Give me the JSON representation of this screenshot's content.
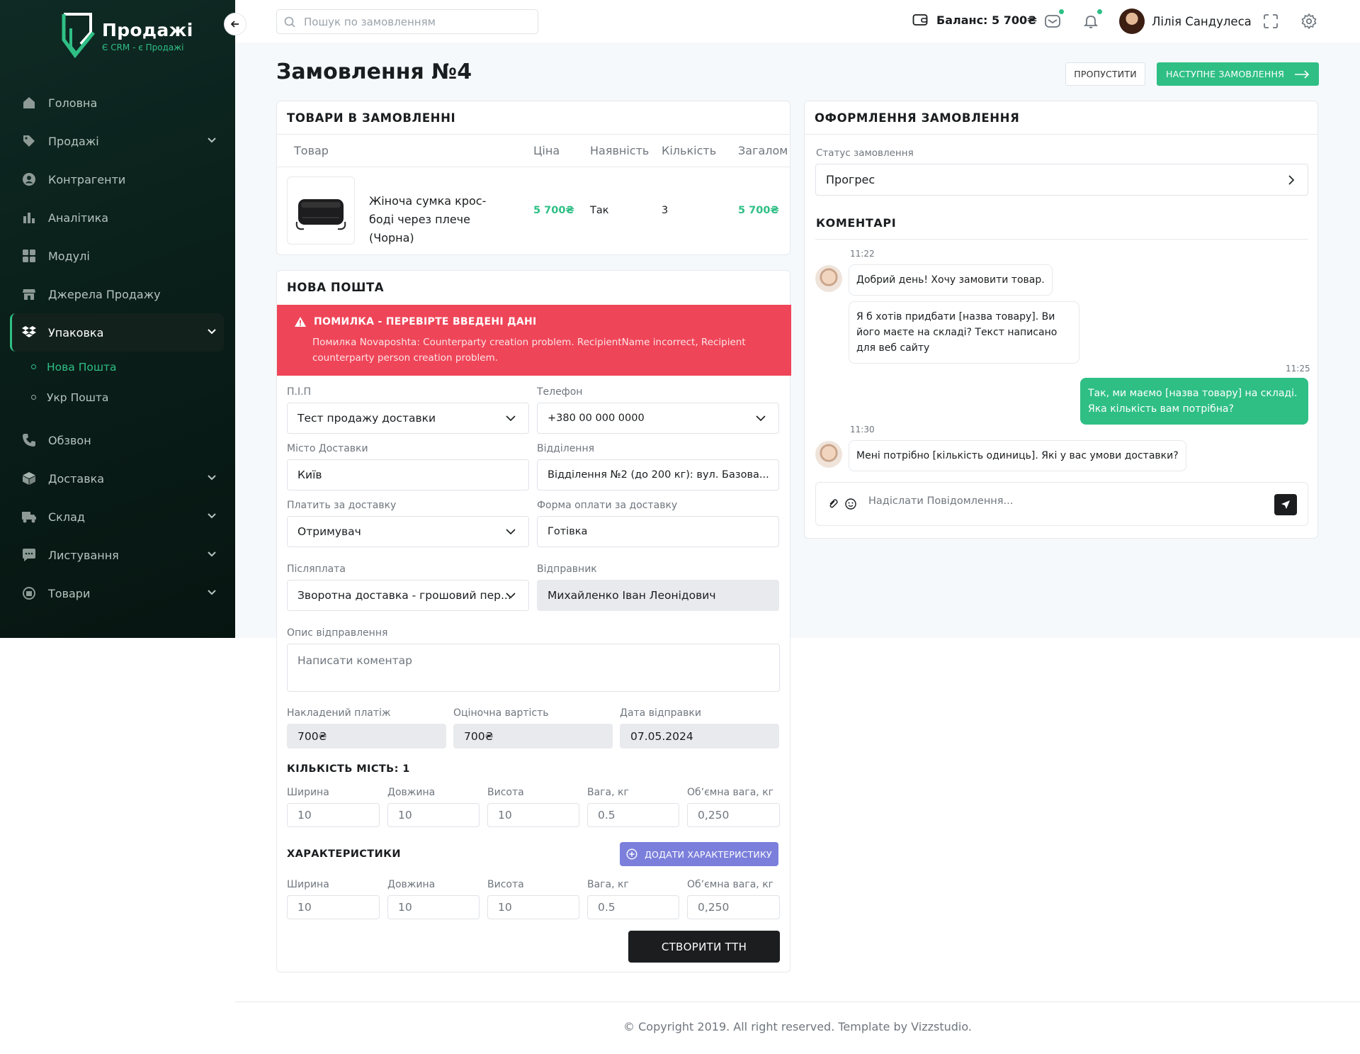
{
  "brand": {
    "name": "Продажі",
    "tagline": "Є CRM - є Продажі"
  },
  "sidebar": {
    "items": [
      {
        "label": "Головна",
        "icon": "home-icon"
      },
      {
        "label": "Продажі",
        "icon": "tag-icon"
      },
      {
        "label": "Контрагенти",
        "icon": "contacts-icon"
      },
      {
        "label": "Аналітика",
        "icon": "chart-icon"
      },
      {
        "label": "Модулі",
        "icon": "grid-icon"
      },
      {
        "label": "Джерела Продажу",
        "icon": "store-icon"
      },
      {
        "label": "Упаковка",
        "icon": "box-icon"
      },
      {
        "label": "Обзвон",
        "icon": "phone-icon"
      },
      {
        "label": "Доставка",
        "icon": "cube-icon"
      },
      {
        "label": "Склад",
        "icon": "truck-icon"
      },
      {
        "label": "Листування",
        "icon": "chat-icon"
      },
      {
        "label": "Товари",
        "icon": "gift-icon"
      }
    ],
    "sub_items": [
      {
        "label": "Нова Пошта"
      },
      {
        "label": "Укр Пошта"
      }
    ]
  },
  "header": {
    "search_placeholder": "Пошук по замовленням",
    "balance": "Баланс: 5 700₴",
    "user_name": "Лілія Сандулеса"
  },
  "page": {
    "title": "Замовлення №4",
    "skip": "ПРОПУСТИТИ",
    "next": "НАСТУПНЕ ЗАМОВЛЕННЯ"
  },
  "products": {
    "title": "ТОВАРИ В ЗАМОВЛЕННІ",
    "columns": [
      "Товар",
      "Ціна",
      "Наявність",
      "Кількість",
      "Загалом"
    ],
    "rows": [
      {
        "name": "Жіноча сумка крос-боді через плече (Чорна)",
        "price": "5 700₴",
        "availability": "Так",
        "qty": "3",
        "total": "5 700₴"
      }
    ]
  },
  "np": {
    "title": "НОВА ПОШТА",
    "error_title": "ПОМИЛКА - ПЕРЕВІРТЕ ВВЕДЕНІ ДАНІ",
    "error_text": "Помилка Novaposhta: Counterparty creation problem. RecipientName incorrect, Recipient counterparty person creation problem.",
    "pip_label": "П.І.П",
    "pip_value": "Тест продажу доставки",
    "phone_label": "Телефон",
    "phone_value": "+380 00 000 0000",
    "city_label": "Місто Доставки",
    "city_value": "Київ",
    "branch_label": "Відділення",
    "branch_value": "Відділення №2 (до 200 кг): вул. Базова...",
    "payer_label": "Платить за доставку",
    "payer_value": "Отримувач",
    "payform_label": "Форма оплати за доставку",
    "payform_value": "Готівка",
    "cod_label": "Післяплата",
    "cod_value": "Зворотна доставка - грошовий пер...",
    "sender_label": "Відправник",
    "sender_value": "Михайленко Іван Леонідович",
    "desc_label": "Опис відправлення",
    "desc_placeholder": "Написати коментар",
    "invoice_label": "Накладений платіж",
    "invoice_value": "700₴",
    "estimate_label": "Оціночна вартість",
    "estimate_value": "700₴",
    "date_label": "Дата відправки",
    "date_value": "07.05.2024",
    "places_title": "КІЛЬКІСТЬ МІСТЬ: 1",
    "dims_labels": [
      "Ширина",
      "Довжина",
      "Висота",
      "Вага, кг",
      "Обʼємна вага, кг"
    ],
    "dims_values": [
      "10",
      "10",
      "10",
      "0.5",
      "0,250"
    ],
    "chars_title": "ХАРАКТЕРИСТИКИ",
    "add_char": "ДОДАТИ ХАРАКТЕРИСТИКУ",
    "chars_values": [
      "10",
      "10",
      "10",
      "0.5",
      "0,250"
    ],
    "create_ttn": "СТВОРИТИ ТТН"
  },
  "order": {
    "title": "ОФОРМЛЕННЯ ЗАМОВЛЕННЯ",
    "status_label": "Статус замовлення",
    "status_value": "Прогрес",
    "comments_title": "КОМЕНТАРІ",
    "messages": [
      {
        "time": "11:22",
        "text": "Добрий день! Хочу замовити товар."
      },
      {
        "text": "Я б хотів придбати [назва товару]. Ви його маєте на складі? Текст написано для веб сайту"
      },
      {
        "time": "11:25",
        "text": "Так, ми маємо [назва товару] на складі. Яка кількість вам потрібна?"
      },
      {
        "time": "11:30",
        "text": "Мені потрібно [кількість одиниць]. Які у вас умови доставки?"
      }
    ],
    "composer_placeholder": "Надіслати Повідомлення..."
  },
  "footer": {
    "text": "© Copyright 2019. All right reserved. Template by Vizzstudio."
  },
  "colors": {
    "accent": "#2fbf85",
    "error": "#ef4558",
    "secondary": "#7b7fdb",
    "sidebar": "#0a1f1a"
  }
}
